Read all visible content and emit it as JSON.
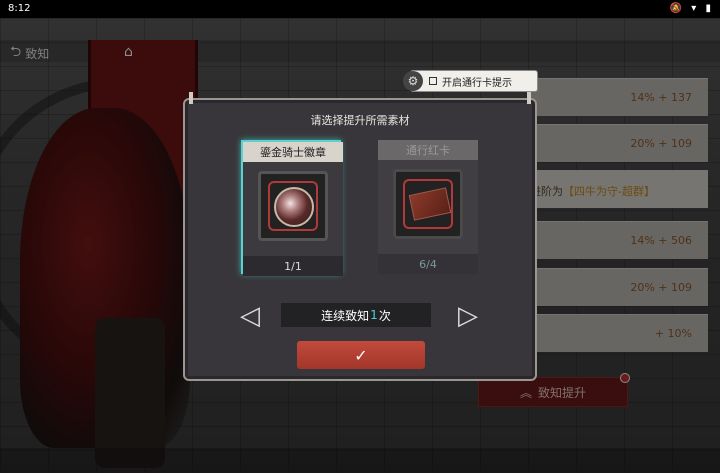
{
  "status_bar": {
    "time": "8:12",
    "icons": "🔕 ▾ ▮"
  },
  "nav": {
    "back_label": "致知",
    "back_icon": "back-arrow-icon",
    "home_icon": "home-icon"
  },
  "hint": {
    "label": "开启通行卡提示",
    "checked": false
  },
  "right_panel": {
    "rows": [
      {
        "value": "14% + 137"
      },
      {
        "value": "20% + 109"
      },
      {
        "value": "14% + 506"
      },
      {
        "value": "20% + 109"
      },
      {
        "value": "+ 10%"
      }
    ],
    "rank_text_prefix": "进阶为",
    "rank_text_name": "【四牛为守-超群】",
    "promote_label": "致知提升"
  },
  "modal": {
    "title": "请选择提升所需素材",
    "cards": [
      {
        "name": "鎏金骑士徽章",
        "count": "1/1",
        "selected": true
      },
      {
        "name": "通行红卡",
        "count": "6/4",
        "selected": false
      }
    ],
    "consecutive": {
      "prefix": "连续致知",
      "count": "1",
      "suffix": "次"
    },
    "confirm_icon": "✓"
  }
}
